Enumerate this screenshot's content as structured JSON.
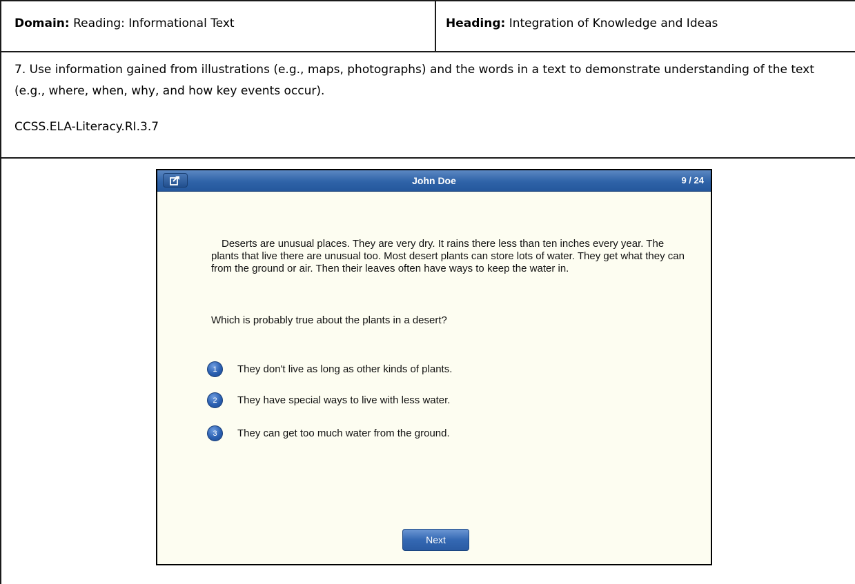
{
  "header": {
    "domain_label": "Domain:",
    "domain_value": "Reading: Informational Text",
    "heading_label": "Heading:",
    "heading_value": "Integration of Knowledge and Ideas"
  },
  "standard": {
    "text": "7. Use information gained from illustrations (e.g., maps, photographs) and the words in a text to demonstrate understanding of the text (e.g., where, when, why, and how key events occur).",
    "code": "CCSS.ELA-Literacy.RI.3.7"
  },
  "app": {
    "title": "John Doe",
    "counter": "9 / 24",
    "share_icon": "share-icon",
    "passage": "Deserts are unusual places. They are very dry. It rains there less than ten inches every year. The plants that live there are unusual too. Most desert plants can store lots of water. They get what they can from the ground or air. Then their leaves often have ways to keep the water in.",
    "question": "Which is probably true about the plants in a desert?",
    "choices": [
      {
        "number": "1",
        "text": "They don't live as long as other kinds of plants."
      },
      {
        "number": "2",
        "text": "They have special ways to live with less water."
      },
      {
        "number": "3",
        "text": "They can get too much water from the ground."
      }
    ],
    "next_label": "Next"
  }
}
